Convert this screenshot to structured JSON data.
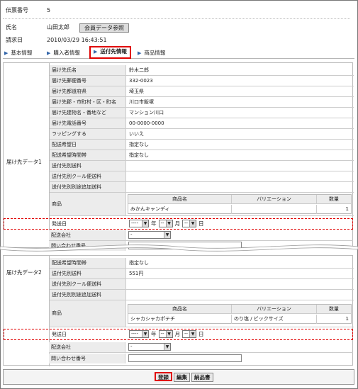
{
  "header": {
    "slip_label": "伝票番号",
    "slip_value": "5",
    "name_label": "氏名",
    "name_value": "山田太郎",
    "member_button": "会員データ参照",
    "billing_label": "請求日",
    "billing_value": "2010/03/29 16:43:51"
  },
  "tabs": [
    {
      "label": "基本情報"
    },
    {
      "label": "購入者情報"
    },
    {
      "label": "送付先情報"
    },
    {
      "label": "商品情報"
    }
  ],
  "dest1": {
    "label": "届け先データ1",
    "rows": [
      {
        "k": "届け先氏名",
        "v": "鈴木二郎"
      },
      {
        "k": "届け先郵便番号",
        "v": "332-0023"
      },
      {
        "k": "届け先都道府県",
        "v": "埼玉県"
      },
      {
        "k": "届け先郡・市町村・区・町名",
        "v": "川口市飯塚"
      },
      {
        "k": "届け先建物名・番地など",
        "v": "マンション川口"
      },
      {
        "k": "届け先電話番号",
        "v": "00-0000-0000"
      },
      {
        "k": "ラッピングする",
        "v": "いいえ"
      },
      {
        "k": "配送希望日",
        "v": "指定なし"
      },
      {
        "k": "配送希望時間帯",
        "v": "指定なし"
      },
      {
        "k": "送付先別送料",
        "v": ""
      },
      {
        "k": "送付先別クール便送料",
        "v": ""
      },
      {
        "k": "送付先別別途追加送料",
        "v": ""
      }
    ],
    "product_label": "商品",
    "product_headers": [
      "商品名",
      "バリエーション",
      "数量"
    ],
    "product_row": {
      "name": "みかんキャンディ",
      "variation": "",
      "qty": "1"
    },
    "ship_date_label": "発送日",
    "ship_date": {
      "year": "----",
      "month": "--",
      "day": "--",
      "year_unit": "年",
      "month_unit": "月",
      "day_unit": "日"
    },
    "carrier_label": "配送会社",
    "carrier_value": "-",
    "tracking_label": "問い合わせ番号"
  },
  "dest2": {
    "label": "届け先データ2",
    "rows": [
      {
        "k": "配送希望時間帯",
        "v": "指定なし"
      },
      {
        "k": "送付先別送料",
        "v": "551円"
      },
      {
        "k": "送付先別クール便送料",
        "v": ""
      },
      {
        "k": "送付先別別途追加送料",
        "v": ""
      }
    ],
    "product_label": "商品",
    "product_headers": [
      "商品名",
      "バリエーション",
      "数量"
    ],
    "product_row": {
      "name": "シャカシャカポテチ",
      "variation": "のり塩 / ビックサイズ",
      "qty": "1"
    },
    "ship_date_label": "発送日",
    "ship_date": {
      "year": "----",
      "month": "--",
      "day": "--",
      "year_unit": "年",
      "month_unit": "月",
      "day_unit": "日"
    },
    "carrier_label": "配送会社",
    "carrier_value": "-",
    "tracking_label": "問い合わせ番号"
  },
  "footer": {
    "register": "登録",
    "edit": "編集",
    "delivery_note": "納品書"
  },
  "colors": {
    "highlight": "#e00000",
    "label_bg": "#ececec",
    "tab_arrow": "#3366aa"
  }
}
